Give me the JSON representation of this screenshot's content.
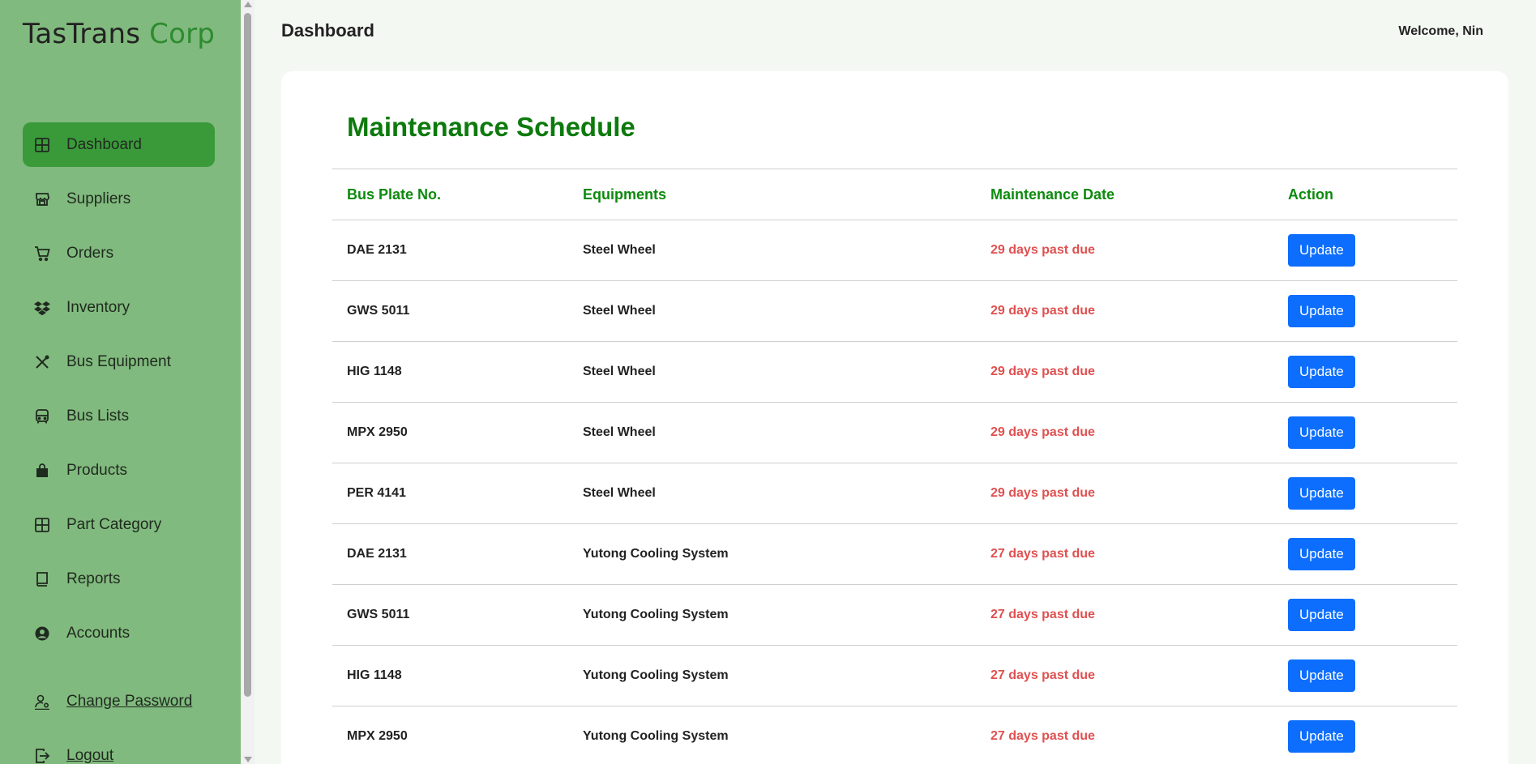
{
  "brand": {
    "name": "TasTrans",
    "accent": "Corp"
  },
  "sidebar": {
    "items": [
      {
        "label": "Dashboard",
        "icon": "grid-icon",
        "active": true
      },
      {
        "label": "Suppliers",
        "icon": "store-icon"
      },
      {
        "label": "Orders",
        "icon": "cart-icon"
      },
      {
        "label": "Inventory",
        "icon": "dropbox-icon"
      },
      {
        "label": "Bus Equipment",
        "icon": "tools-icon"
      },
      {
        "label": "Bus Lists",
        "icon": "bus-icon"
      },
      {
        "label": "Products",
        "icon": "bag-icon"
      },
      {
        "label": "Part Category",
        "icon": "grid-icon"
      },
      {
        "label": "Reports",
        "icon": "book-icon"
      },
      {
        "label": "Accounts",
        "icon": "person-circle-icon"
      }
    ],
    "lower": [
      {
        "label": "Change Password",
        "icon": "person-gear-icon"
      },
      {
        "label": "Logout",
        "icon": "logout-icon"
      }
    ]
  },
  "header": {
    "title": "Dashboard",
    "welcome": "Welcome, Nin"
  },
  "schedule": {
    "title": "Maintenance Schedule",
    "columns": [
      "Bus Plate No.",
      "Equipments",
      "Maintenance Date",
      "Action"
    ],
    "rows": [
      {
        "plate": "DAE 2131",
        "equipment": "Steel Wheel",
        "date": "29 days past due",
        "action": "Update"
      },
      {
        "plate": "GWS 5011",
        "equipment": "Steel Wheel",
        "date": "29 days past due",
        "action": "Update"
      },
      {
        "plate": "HIG 1148",
        "equipment": "Steel Wheel",
        "date": "29 days past due",
        "action": "Update"
      },
      {
        "plate": "MPX 2950",
        "equipment": "Steel Wheel",
        "date": "29 days past due",
        "action": "Update"
      },
      {
        "plate": "PER 4141",
        "equipment": "Steel Wheel",
        "date": "29 days past due",
        "action": "Update"
      },
      {
        "plate": "DAE 2131",
        "equipment": "Yutong Cooling System",
        "date": "27 days past due",
        "action": "Update"
      },
      {
        "plate": "GWS 5011",
        "equipment": "Yutong Cooling System",
        "date": "27 days past due",
        "action": "Update"
      },
      {
        "plate": "HIG 1148",
        "equipment": "Yutong Cooling System",
        "date": "27 days past due",
        "action": "Update"
      },
      {
        "plate": "MPX 2950",
        "equipment": "Yutong Cooling System",
        "date": "27 days past due",
        "action": "Update"
      }
    ]
  },
  "colors": {
    "sidebar_bg": "#81ba7e",
    "active_item": "#3a9a3a",
    "title_green": "#0d7a0d",
    "overdue_red": "#e05050",
    "button_blue": "#0d6efd"
  }
}
